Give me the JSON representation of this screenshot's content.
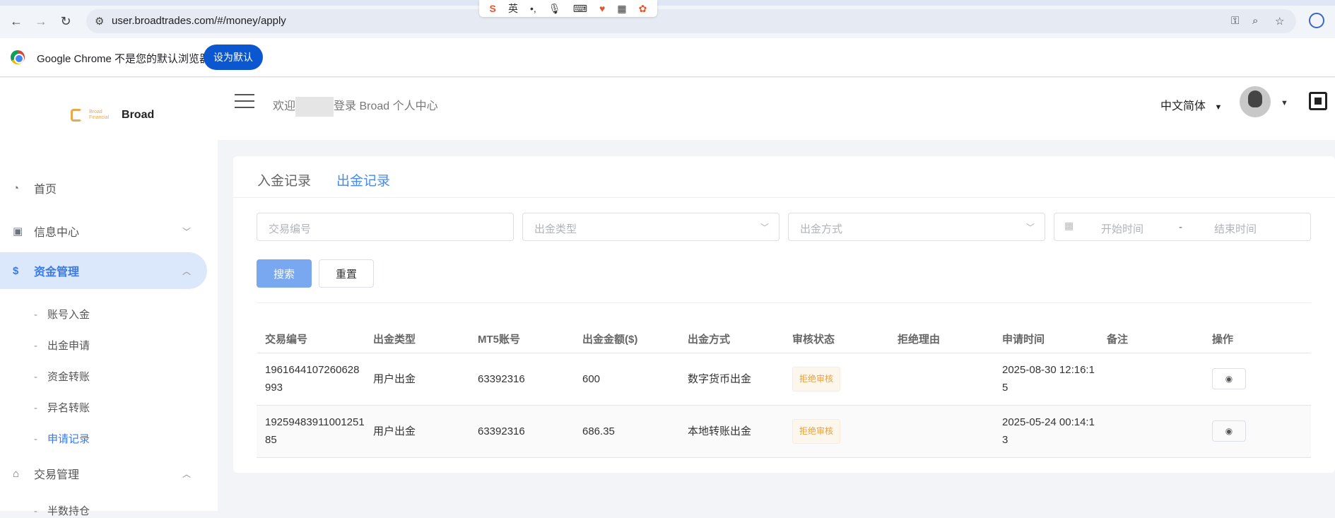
{
  "browser": {
    "url": "user.broadtrades.com/#/money/apply",
    "infobar_text": "Google Chrome 不是您的默认浏览器",
    "set_default_label": "设为默认",
    "ime_lang": "英"
  },
  "sidebar": {
    "logo_sub_1": "Broad",
    "logo_sub_2": "Financial",
    "logo_text": "Broad",
    "items": [
      {
        "label": "首页",
        "icon": "dashboard-icon"
      },
      {
        "label": "信息中心",
        "icon": "contact-icon"
      },
      {
        "label": "资金管理",
        "icon": "dollar-icon"
      },
      {
        "label": "交易管理",
        "icon": "bank-icon"
      }
    ],
    "fund_sub": [
      "账号入金",
      "出金申请",
      "资金转账",
      "异名转账",
      "申请记录"
    ],
    "trade_sub_first": "半数持仓"
  },
  "header": {
    "welcome_prefix": "欢迎",
    "welcome_suffix": "登录 Broad 个人中心",
    "language": "中文简体"
  },
  "tabs": {
    "deposit": "入金记录",
    "withdraw": "出金记录"
  },
  "filters": {
    "tx_no_placeholder": "交易编号",
    "withdraw_type_placeholder": "出金类型",
    "withdraw_method_placeholder": "出金方式",
    "start_time_placeholder": "开始时间",
    "range_sep": "-",
    "end_time_placeholder": "结束时间",
    "search_label": "搜索",
    "reset_label": "重置"
  },
  "table": {
    "headers": [
      "交易编号",
      "出金类型",
      "MT5账号",
      "出金金额($)",
      "出金方式",
      "审核状态",
      "拒绝理由",
      "申请时间",
      "备注",
      "操作"
    ],
    "rows": [
      {
        "tx_no": "1961644107260628993",
        "type": "用户出金",
        "mt5": "63392316",
        "amount": "600",
        "method": "数字货币出金",
        "status": "拒绝审核",
        "reason": "",
        "time": "2025-08-30 12:16:15",
        "note": ""
      },
      {
        "tx_no": "1925948391100125185",
        "type": "用户出金",
        "mt5": "63392316",
        "amount": "686.35",
        "method": "本地转账出金",
        "status": "拒绝审核",
        "reason": "",
        "time": "2025-05-24 00:14:13",
        "note": ""
      }
    ]
  },
  "colors": {
    "accent": "#4a8ae8",
    "warning": "#e6a23c",
    "active_bg": "#dbe8fb"
  }
}
